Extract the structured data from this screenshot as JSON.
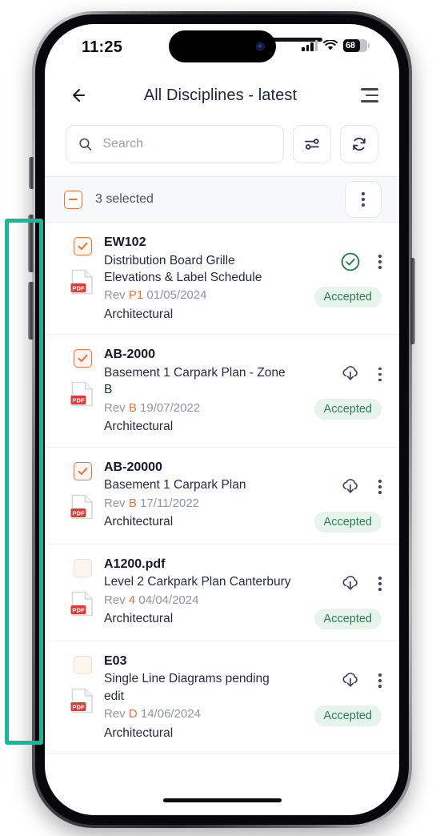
{
  "status_bar": {
    "time": "11:25",
    "signal_icon": "cellular-signal-icon",
    "wifi_icon": "wifi-icon",
    "battery_percent": "68",
    "battery_icon": "battery-icon"
  },
  "header": {
    "back_icon": "back-arrow-icon",
    "title": "All Disciplines - latest",
    "menu_icon": "hamburger-menu-icon"
  },
  "search": {
    "icon": "search-icon",
    "value": "",
    "placeholder": "Search",
    "filter_icon": "filter-sliders-icon",
    "refresh_icon": "refresh-sync-icon"
  },
  "selection_bar": {
    "checkbox_icon": "indeterminate-checkbox-icon",
    "checkbox_state": "indeterminate",
    "count_label": "3 selected",
    "overflow_icon": "kebab-menu-icon"
  },
  "colors": {
    "accent_orange": "#e8743b",
    "status_green": "#2e7d4f",
    "badge_bg": "#e6f4ec",
    "highlight_teal": "#17b897",
    "pdf_red": "#e03a35"
  },
  "documents": [
    {
      "code": "EW102",
      "title": "Distribution Board Grille Elevations & Label Schedule",
      "rev_label": "Rev",
      "rev_value": "P1",
      "rev_date": "01/05/2024",
      "discipline": "Architectural",
      "file_icon": "pdf-file-icon",
      "file_type": "PDF",
      "checkbox_state": "checked",
      "status_icon": "check-circle-icon",
      "badge": "Accepted",
      "overflow_icon": "kebab-menu-icon"
    },
    {
      "code": "AB-2000",
      "title": "Basement 1 Carpark Plan - Zone B",
      "rev_label": "Rev",
      "rev_value": "B",
      "rev_date": "19/07/2022",
      "discipline": "Architectural",
      "file_icon": "pdf-file-icon",
      "file_type": "PDF",
      "checkbox_state": "checked",
      "status_icon": "cloud-download-icon",
      "badge": "Accepted",
      "overflow_icon": "kebab-menu-icon"
    },
    {
      "code": "AB-20000",
      "title": "Basement 1 Carpark Plan",
      "rev_label": "Rev",
      "rev_value": "B",
      "rev_date": "17/11/2022",
      "discipline": "Architectural",
      "file_icon": "pdf-file-icon",
      "file_type": "PDF",
      "checkbox_state": "checked",
      "status_icon": "cloud-download-icon",
      "badge": "Accepted",
      "overflow_icon": "kebab-menu-icon"
    },
    {
      "code": "A1200.pdf",
      "title": "Level 2 Carkpark Plan Canterbury",
      "rev_label": "Rev",
      "rev_value": "4",
      "rev_date": "04/04/2024",
      "discipline": "Architectural",
      "file_icon": "pdf-file-icon",
      "file_type": "PDF",
      "checkbox_state": "unchecked",
      "status_icon": "cloud-download-icon",
      "badge": "Accepted",
      "overflow_icon": "kebab-menu-icon"
    },
    {
      "code": "E03",
      "title": "Single Line Diagrams pending edit",
      "rev_label": "Rev",
      "rev_value": "D",
      "rev_date": "14/06/2024",
      "discipline": "Architectural",
      "file_icon": "pdf-file-icon",
      "file_type": "PDF",
      "checkbox_state": "unchecked",
      "status_icon": "cloud-download-icon",
      "badge": "Accepted",
      "overflow_icon": "kebab-menu-icon"
    }
  ]
}
